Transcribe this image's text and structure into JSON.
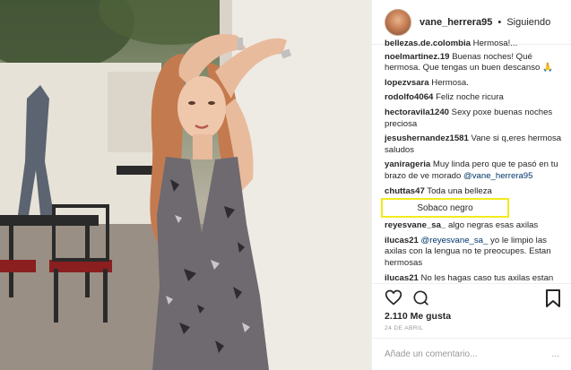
{
  "post": {
    "username": "vane_herrera95",
    "separator": "•",
    "follow_status": "Siguiendo",
    "likes": "2.110 Me gusta",
    "date": "24 DE ABRIL",
    "add_comment_placeholder": "Añade un comentario...",
    "more": "..."
  },
  "comments": [
    {
      "user": "bellezas.de.colombia",
      "text": "Hermosa!..."
    },
    {
      "user": "noelmartinez.19",
      "text": "Buenas noches! Qué hermosa. Que tengas un buen descanso 🙏"
    },
    {
      "user": "lopezvsara",
      "text": "Hermosa."
    },
    {
      "user": "rodolfo4064",
      "text": "Feliz noche ricura"
    },
    {
      "user": "hectoravila1240",
      "text": "Sexy poxe buenas noches preciosa"
    },
    {
      "user": "jesushernandez1581",
      "text": "Vane si q,eres hermosa saludos"
    },
    {
      "user": "yanirageria",
      "text": "Muy linda pero que te pasó en tu brazo de ve morado",
      "mention": "@vane_herrera95"
    },
    {
      "user": "chuttas47",
      "text": "Toda una belleza"
    },
    {
      "user": "reyesvane_sa_",
      "text": "algo negras esas axilas"
    },
    {
      "user": "ilucas21",
      "mention": "@reyesvane_sa_",
      "text": "yo le limpio las axilas con la lengua no te preocupes. Estan hermosas"
    },
    {
      "user": "ilucas21",
      "text": "No les hagas caso tus axilas estan"
    }
  ],
  "highlight_text": "Sobaco negro",
  "icons": [
    "heart-icon",
    "comment-icon",
    "bookmark-icon"
  ]
}
